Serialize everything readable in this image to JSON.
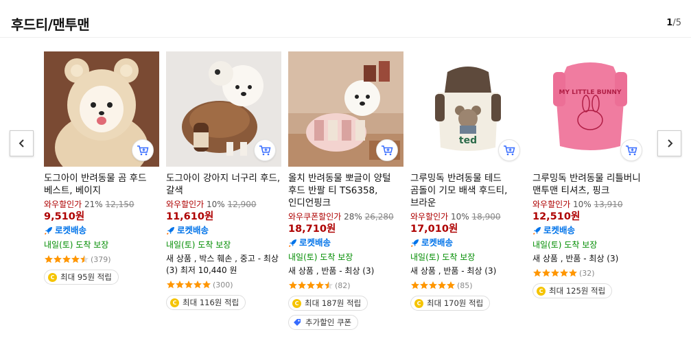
{
  "header": {
    "title": "후드티/맨투맨",
    "page_current": "1",
    "page_total": "/5"
  },
  "colors": {
    "price_red": "#ae0000",
    "rocket_blue": "#0073e9",
    "arrival_green": "#008c00"
  },
  "products": [
    {
      "name": "도그아이 반려동물 곰 후드 베스트, 베이지",
      "discount_label": "와우할인가",
      "discount_rate": "21%",
      "original_price": "12,150",
      "price": "9,510원",
      "rocket_label": "로켓배송",
      "arrival": "내일(토) 도착 보장",
      "options": "",
      "rating_value": 4.5,
      "review_count": "(379)",
      "reward": "최대 95원 적립",
      "coupon": ""
    },
    {
      "name": "도그아이 강아지 너구리 후드, 갈색",
      "discount_label": "와우할인가",
      "discount_rate": "10%",
      "original_price": "12,900",
      "price": "11,610원",
      "rocket_label": "로켓배송",
      "arrival": "내일(토) 도착 보장",
      "options": "새 상품 , 박스 훼손 , 중고 - 최상 (3) 최저 10,440 원",
      "rating_value": 5,
      "review_count": "(300)",
      "reward": "최대 116원 적립",
      "coupon": ""
    },
    {
      "name": "올치 반려동물 뽀글이 양털 후드 반팔 티 TS6358, 인디언핑크",
      "discount_label": "와우쿠폰할인가",
      "discount_rate": "28%",
      "original_price": "26,280",
      "price": "18,710원",
      "rocket_label": "로켓배송",
      "arrival": "내일(토) 도착 보장",
      "options": "새 상품 , 반품 - 최상 (3)",
      "rating_value": 4.5,
      "review_count": "(82)",
      "reward": "최대 187원 적립",
      "coupon": "추가할인 쿠폰"
    },
    {
      "name": "그루밍독 반려동물 테드 곰돌이 기모 배색 후드티, 브라운",
      "discount_label": "와우할인가",
      "discount_rate": "10%",
      "original_price": "18,900",
      "price": "17,010원",
      "rocket_label": "로켓배송",
      "arrival": "내일(토) 도착 보장",
      "options": "새 상품 , 반품 - 최상 (3)",
      "rating_value": 5,
      "review_count": "(85)",
      "reward": "최대 170원 적립",
      "coupon": ""
    },
    {
      "name": "그루밍독 반려동물 리틀버니 맨투맨 티셔츠, 핑크",
      "discount_label": "와우할인가",
      "discount_rate": "10%",
      "original_price": "13,910",
      "price": "12,510원",
      "rocket_label": "로켓배송",
      "arrival": "내일(토) 도착 보장",
      "options": "새 상품 , 반품 - 최상 (3)",
      "rating_value": 5,
      "review_count": "(32)",
      "reward": "최대 125원 적립",
      "coupon": ""
    }
  ],
  "thumb_text": {
    "ted_print": "ted",
    "bunny_print": "MY LITTLE BUNNY"
  },
  "icons": {
    "prev": "chevron-left-icon",
    "next": "chevron-right-icon",
    "cart": "cart-add-icon",
    "rocket": "rocket-icon",
    "coin": "coin-icon",
    "coupon": "coupon-tag-icon",
    "star": "star-icon"
  }
}
